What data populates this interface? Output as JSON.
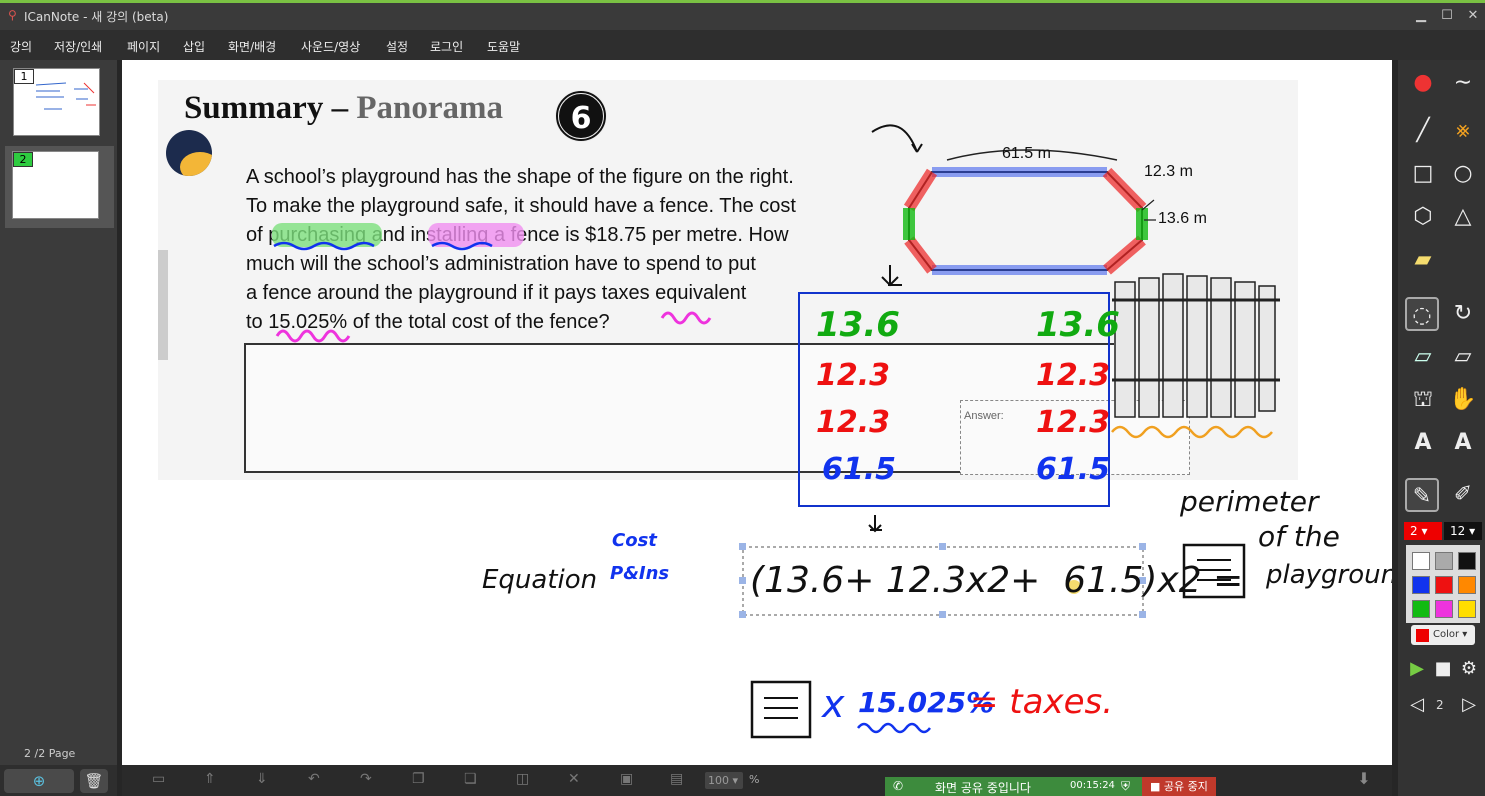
{
  "window": {
    "title": "ICanNote - 새 강의 (beta)",
    "min": "▁",
    "max": "☐",
    "close": "✕"
  },
  "menu": [
    "강의",
    "저장/인쇄",
    "페이지",
    "삽입",
    "화면/배경",
    "사운드/영상",
    "설정",
    "로그인",
    "도움말"
  ],
  "slides": [
    {
      "num": "1"
    },
    {
      "num": "2"
    }
  ],
  "page_info": "2  /2 Page",
  "doc": {
    "title_a": "Summary –",
    "title_b": "Panorama",
    "title_num": "6",
    "lines": [
      "A school’s playground has the shape of the figure on the right.",
      "To make the playground safe, it should have a fence. The cost",
      "of purchasing and installing a fence is $18.75 per metre. How",
      "much will the school’s administration have to spend to put",
      "a fence around the playground if it pays taxes equivalent",
      "to 15.025% of the total cost of the fence?"
    ],
    "answer_label": "Answer:",
    "dim_top": "61.5 m",
    "dim_diag": "12.3 m",
    "dim_side": "13.6 m"
  },
  "ink": {
    "left_col": [
      "13.6",
      "12.3",
      "12.3",
      "61.5"
    ],
    "right_col": [
      "13.6",
      "12.3",
      "12.3",
      "61.5"
    ],
    "equation": "Equation",
    "cost1": "Cost",
    "cost2": "P&Ins",
    "expr": "(13.6+ 12.3x2+  61.5)x2 =",
    "perimeter1": "perimeter",
    "perimeter2": "of the",
    "perimeter3": "playground",
    "tax_times": "x",
    "tax_pct": "15.025%",
    "tax_eq": "= taxes."
  },
  "share": {
    "status": "화면 공유 중입니다",
    "time": "00:15:24",
    "stop": "공유 중지"
  },
  "zoom": "100",
  "zoom_unit": "%",
  "right": {
    "stroke_size": "2",
    "font_size": "12",
    "color_label": "Color",
    "page": "2"
  },
  "palette": [
    "#ffffff",
    "#aaaaaa",
    "#111111",
    "#1133ee",
    "#ee1111",
    "#ff8800",
    "#11bb11",
    "#ee33dd",
    "#ffdd00"
  ]
}
